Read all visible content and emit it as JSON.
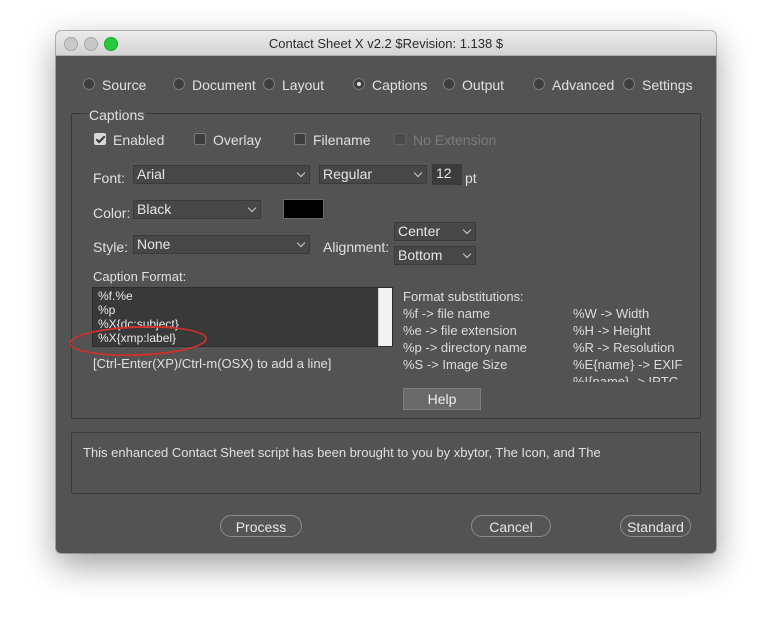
{
  "window": {
    "title": "Contact Sheet X v2.2 $Revision: 1.138 $"
  },
  "tabs": [
    {
      "label": "Source",
      "selected": false
    },
    {
      "label": "Document",
      "selected": false
    },
    {
      "label": "Layout",
      "selected": false
    },
    {
      "label": "Captions",
      "selected": true
    },
    {
      "label": "Output",
      "selected": false
    },
    {
      "label": "Advanced",
      "selected": false
    },
    {
      "label": "Settings",
      "selected": false
    }
  ],
  "captions": {
    "group_label": "Captions",
    "enabled_label": "Enabled",
    "enabled_checked": true,
    "overlay_label": "Overlay",
    "overlay_checked": false,
    "filename_label": "Filename",
    "filename_checked": false,
    "no_extension_label": "No Extension",
    "no_extension_enabled": false,
    "font_label": "Font:",
    "font_value": "Arial",
    "font_style_value": "Regular",
    "font_size_value": "12",
    "font_size_unit": "pt",
    "color_label": "Color:",
    "color_value": "Black",
    "color_swatch": "#000000",
    "style_label": "Style:",
    "style_value": "None",
    "alignment_label": "Alignment:",
    "alignment_h_value": "Center",
    "alignment_v_value": "Bottom",
    "caption_format_label": "Caption Format:",
    "caption_format_lines": [
      "%f.%e",
      "%p",
      "%X{dc:subject}",
      "%X{xmp:label}"
    ],
    "add_line_hint": "[Ctrl-Enter(XP)/Ctrl-m(OSX) to add a line]",
    "substitutions_title": "Format substitutions:",
    "substitutions_left": [
      "%f -> file name",
      "%e -> file extension",
      "%p -> directory name",
      "%S -> Image Size"
    ],
    "substitutions_right": [
      "%W -> Width",
      "%H  -> Height",
      "%R  -> Resolution",
      "%E{name} -> EXIF",
      "%I{name} -> IPTC"
    ],
    "help_button": "Help",
    "highlight_color": "#d0302a"
  },
  "info_text": "This enhanced Contact Sheet script has been brought to you by xbytor, The Icon, and The",
  "buttons": {
    "process": "Process",
    "cancel": "Cancel",
    "standard": "Standard"
  }
}
